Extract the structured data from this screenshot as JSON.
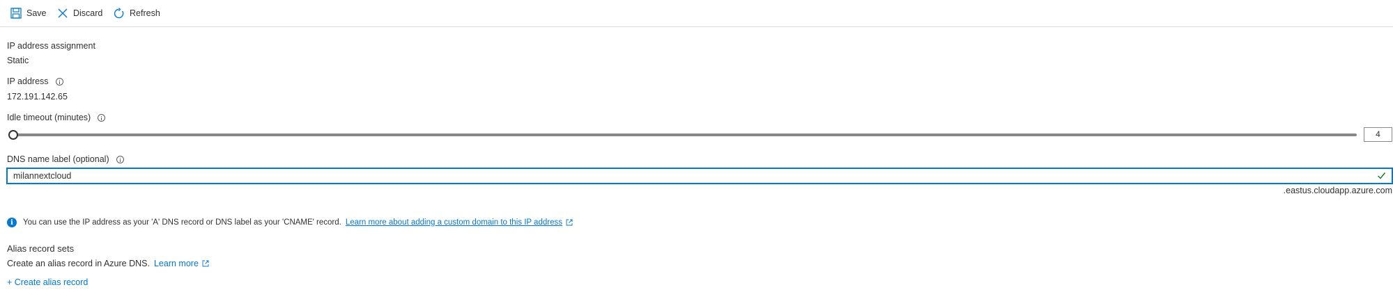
{
  "toolbar": {
    "save_label": "Save",
    "discard_label": "Discard",
    "refresh_label": "Refresh"
  },
  "ip_assignment": {
    "label": "IP address assignment",
    "value": "Static"
  },
  "ip_address": {
    "label": "IP address",
    "value": "172.191.142.65"
  },
  "idle_timeout": {
    "label": "Idle timeout (minutes)",
    "value": "4"
  },
  "dns": {
    "label": "DNS name label (optional)",
    "value": "milannextcloud",
    "suffix": ".eastus.cloudapp.azure.com"
  },
  "info": {
    "text": "You can use the IP address as your 'A' DNS record or DNS label as your 'CNAME' record.",
    "link": "Learn more about adding a custom domain to this IP address"
  },
  "alias": {
    "title": "Alias record sets",
    "description": "Create an alias record in Azure DNS.",
    "learn_more": "Learn more",
    "create_label": "+ Create alias record"
  },
  "colors": {
    "accent": "#0078d4",
    "success": "#107c10",
    "text": "#323130"
  }
}
